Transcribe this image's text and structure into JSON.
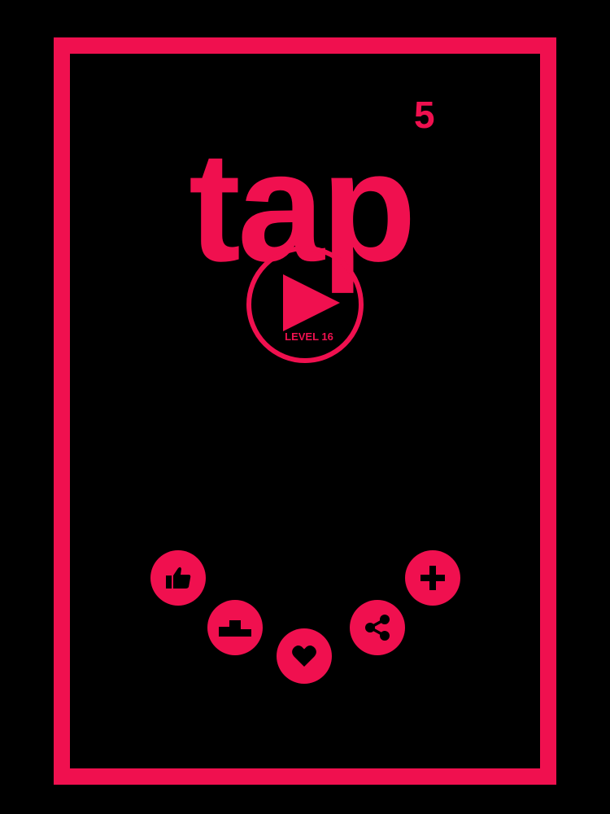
{
  "app": {
    "logo_word": "tap",
    "logo_superscript": "5"
  },
  "play": {
    "icon": "play-icon",
    "level_label": "LEVEL 16"
  },
  "buttons": [
    {
      "name": "like",
      "icon": "thumbs-up-icon"
    },
    {
      "name": "leaderboard",
      "icon": "podium-icon"
    },
    {
      "name": "favorite",
      "icon": "heart-icon"
    },
    {
      "name": "share",
      "icon": "share-icon"
    },
    {
      "name": "more-games",
      "icon": "plus-icon"
    }
  ],
  "colors": {
    "accent": "#f0104f",
    "background": "#000000"
  }
}
